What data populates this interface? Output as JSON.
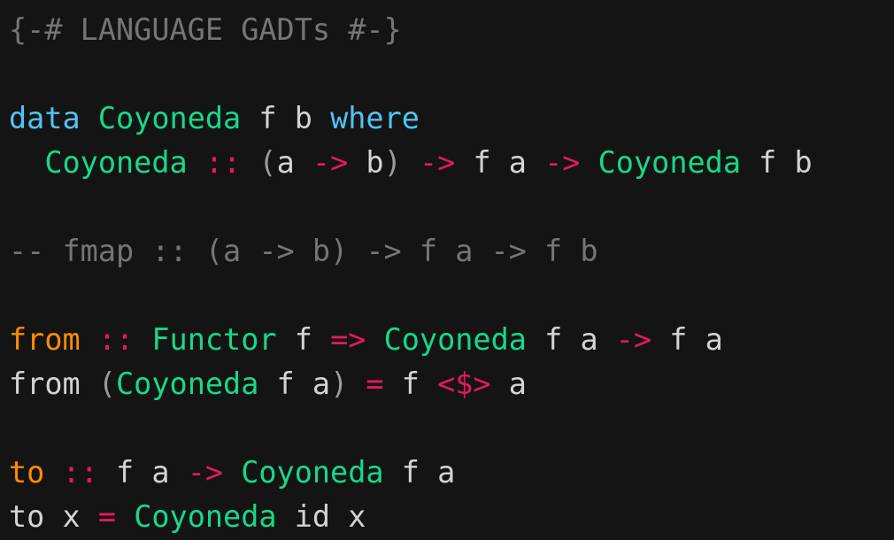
{
  "editor": {
    "language": "haskell",
    "background_color": "#141414",
    "panel_right_color": "#161616",
    "font_size_px": 33.5,
    "line_height_px": 50,
    "palette": {
      "plain": "#d3d3d3",
      "comment": "#757575",
      "keyword": "#4fc3f7",
      "type": "#16d989",
      "operator": "#e5185f",
      "function": "#ff8c00",
      "punctuation": "#9a9a9a"
    },
    "plain_text": "{-# LANGUAGE GADTs #-}\n\ndata Coyoneda f b where\n  Coyoneda :: (a -> b) -> f a -> Coyoneda f b\n\n-- fmap :: (a -> b) -> f a -> f b\n\nfrom :: Functor f => Coyoneda f a -> f a\nfrom (Coyoneda f a) = f <$> a\n\nto :: f a -> Coyoneda f a\nto x = Coyoneda id x"
  },
  "lines": [
    {
      "number": 1,
      "text": "{-# LANGUAGE GADTs #-}",
      "tokens": [
        {
          "t": "{-# LANGUAGE GADTs #-}",
          "c": "comment"
        }
      ]
    },
    {
      "number": 2,
      "text": "",
      "tokens": []
    },
    {
      "number": 3,
      "text": "data Coyoneda f b where",
      "tokens": [
        {
          "t": "data",
          "c": "keyword"
        },
        {
          "t": " ",
          "c": "plain"
        },
        {
          "t": "Coyoneda",
          "c": "type"
        },
        {
          "t": " f b ",
          "c": "plain"
        },
        {
          "t": "where",
          "c": "keyword"
        }
      ]
    },
    {
      "number": 4,
      "text": "  Coyoneda :: (a -> b) -> f a -> Coyoneda f b",
      "tokens": [
        {
          "t": "  ",
          "c": "plain"
        },
        {
          "t": "Coyoneda",
          "c": "type"
        },
        {
          "t": " ",
          "c": "plain"
        },
        {
          "t": "::",
          "c": "operator"
        },
        {
          "t": " ",
          "c": "plain"
        },
        {
          "t": "(",
          "c": "punct"
        },
        {
          "t": "a ",
          "c": "plain"
        },
        {
          "t": "->",
          "c": "operator"
        },
        {
          "t": " b",
          "c": "plain"
        },
        {
          "t": ")",
          "c": "punct"
        },
        {
          "t": " ",
          "c": "plain"
        },
        {
          "t": "->",
          "c": "operator"
        },
        {
          "t": " f a ",
          "c": "plain"
        },
        {
          "t": "->",
          "c": "operator"
        },
        {
          "t": " ",
          "c": "plain"
        },
        {
          "t": "Coyoneda",
          "c": "type"
        },
        {
          "t": " f b",
          "c": "plain"
        }
      ]
    },
    {
      "number": 5,
      "text": "",
      "tokens": []
    },
    {
      "number": 6,
      "text": "-- fmap :: (a -> b) -> f a -> f b",
      "tokens": [
        {
          "t": "-- fmap :: (a -> b) -> f a -> f b",
          "c": "comment"
        }
      ]
    },
    {
      "number": 7,
      "text": "",
      "tokens": []
    },
    {
      "number": 8,
      "text": "from :: Functor f => Coyoneda f a -> f a",
      "tokens": [
        {
          "t": "from",
          "c": "function"
        },
        {
          "t": " ",
          "c": "plain"
        },
        {
          "t": "::",
          "c": "operator"
        },
        {
          "t": " ",
          "c": "plain"
        },
        {
          "t": "Functor",
          "c": "type"
        },
        {
          "t": " f ",
          "c": "plain"
        },
        {
          "t": "=>",
          "c": "operator"
        },
        {
          "t": " ",
          "c": "plain"
        },
        {
          "t": "Coyoneda",
          "c": "type"
        },
        {
          "t": " f a ",
          "c": "plain"
        },
        {
          "t": "->",
          "c": "operator"
        },
        {
          "t": " f a",
          "c": "plain"
        }
      ]
    },
    {
      "number": 9,
      "text": "from (Coyoneda f a) = f <$> a",
      "tokens": [
        {
          "t": "from ",
          "c": "plain"
        },
        {
          "t": "(",
          "c": "punct"
        },
        {
          "t": "Coyoneda",
          "c": "type"
        },
        {
          "t": " f a",
          "c": "plain"
        },
        {
          "t": ")",
          "c": "punct"
        },
        {
          "t": " ",
          "c": "plain"
        },
        {
          "t": "=",
          "c": "operator"
        },
        {
          "t": " f ",
          "c": "plain"
        },
        {
          "t": "<$>",
          "c": "operator"
        },
        {
          "t": " a",
          "c": "plain"
        }
      ]
    },
    {
      "number": 10,
      "text": "",
      "tokens": []
    },
    {
      "number": 11,
      "text": "to :: f a -> Coyoneda f a",
      "tokens": [
        {
          "t": "to",
          "c": "function"
        },
        {
          "t": " ",
          "c": "plain"
        },
        {
          "t": "::",
          "c": "operator"
        },
        {
          "t": " f a ",
          "c": "plain"
        },
        {
          "t": "->",
          "c": "operator"
        },
        {
          "t": " ",
          "c": "plain"
        },
        {
          "t": "Coyoneda",
          "c": "type"
        },
        {
          "t": " f a",
          "c": "plain"
        }
      ]
    },
    {
      "number": 12,
      "text": "to x = Coyoneda id x",
      "tokens": [
        {
          "t": "to x ",
          "c": "plain"
        },
        {
          "t": "=",
          "c": "operator"
        },
        {
          "t": " ",
          "c": "plain"
        },
        {
          "t": "Coyoneda",
          "c": "type"
        },
        {
          "t": " id x",
          "c": "plain"
        }
      ]
    }
  ]
}
